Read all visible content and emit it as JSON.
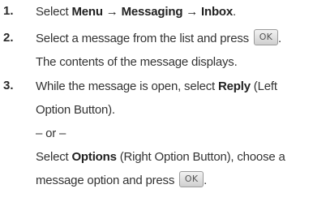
{
  "steps": [
    {
      "number": "1.",
      "select": "Select ",
      "menu_path": "Menu → Messaging → Inbox",
      "end": "."
    },
    {
      "number": "2.",
      "line1": "Select a message from the list and press ",
      "key_label": "OK",
      "end": ".",
      "line2": "The contents of the message displays."
    },
    {
      "number": "3.",
      "l1_pre": "While the message is open, select ",
      "reply": "Reply",
      "l1_post": " (Left",
      "l2": "Option Button).",
      "or_text": "– or –",
      "l4_pre": "Select ",
      "options": "Options",
      "l4_post": " (Right Option Button), choose a",
      "l5": "message option and press ",
      "key_label": "OK",
      "end": "."
    }
  ]
}
